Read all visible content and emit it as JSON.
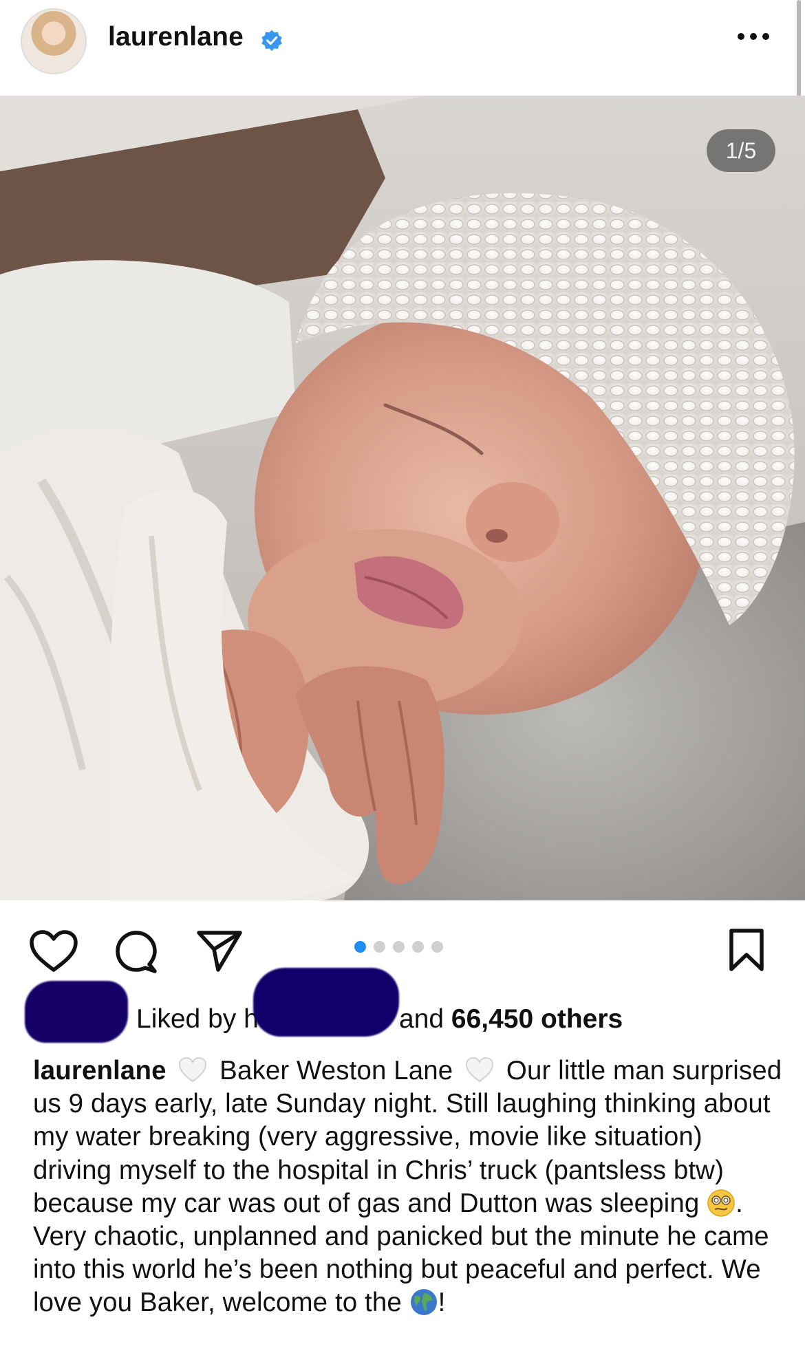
{
  "post": {
    "username": "laurenlane",
    "verified": true,
    "more_icon": "more-horizontal-icon",
    "carousel_counter": "1/5",
    "carousel_total": 5,
    "carousel_current": 1
  },
  "actions": {
    "like_icon": "heart-outline-icon",
    "comment_icon": "comment-icon",
    "share_icon": "paper-plane-icon",
    "save_icon": "bookmark-outline-icon"
  },
  "likes": {
    "prefix": "Liked by ",
    "redacted_name_fragment": "h",
    "suffix_and": "and ",
    "count_text": "66,450 others"
  },
  "caption": {
    "username": "laurenlane",
    "segment1": "Baker Weston Lane",
    "segment2": "Our little man surprised us 9 days early, late Sunday night. Still laughing thinking about my water breaking (very aggressive, movie like situation) driving myself to the hospital in Chris’ truck (pantsless btw) because my car was out of gas and Dutton was sleeping",
    "segment3": ". Very chaotic, unplanned and panicked but the minute he came into this world he’s been nothing but peaceful and perfect. We love you Baker, welcome to the",
    "segment4": "!",
    "emoji_heart": "white-heart-icon",
    "emoji_face": "woozy-spiral-eyes-face-icon",
    "emoji_globe": "globe-icon"
  },
  "colors": {
    "accent_blue": "#1f8ef1",
    "verified_blue": "#3897f0",
    "redaction": "#150068",
    "text": "#111111"
  }
}
